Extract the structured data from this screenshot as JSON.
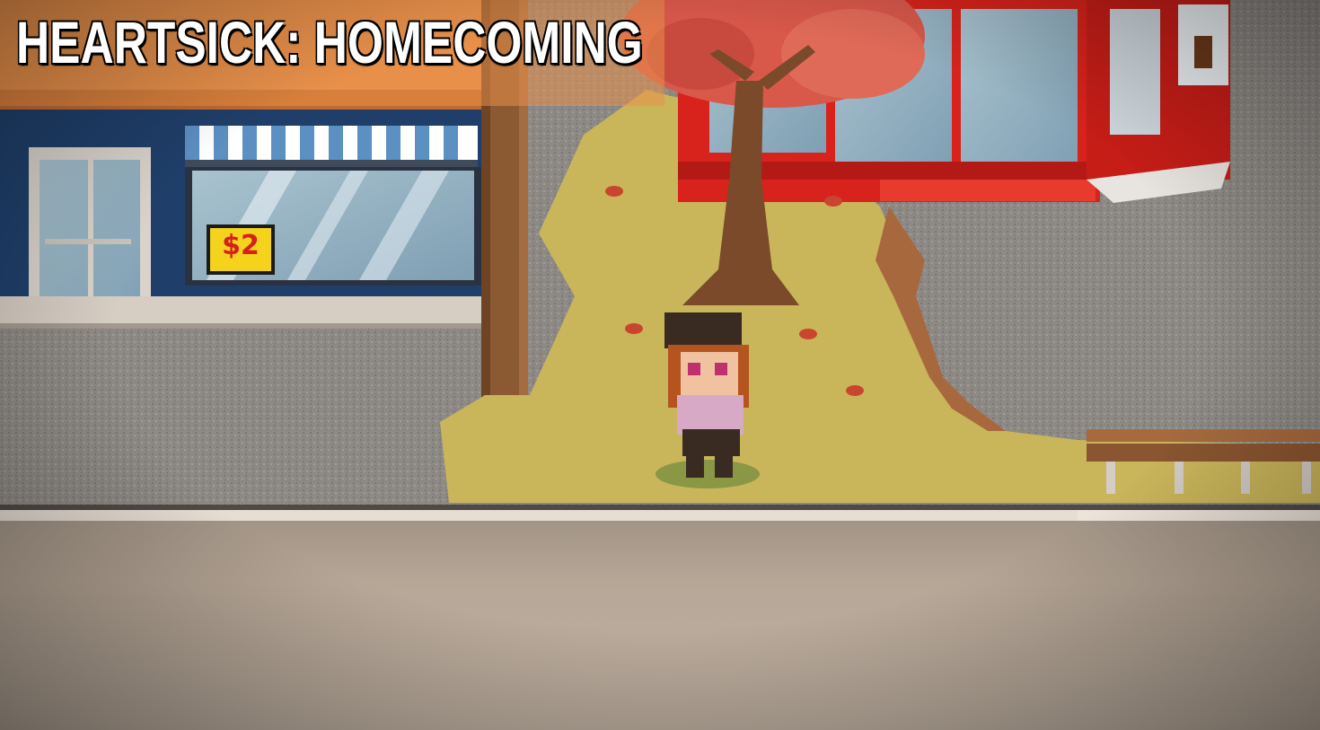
{
  "game": {
    "title": "HEARTSICK: HOMECOMING"
  },
  "scene": {
    "shop_sign_price": "$2",
    "character": "girl-with-beret",
    "colors": {
      "storefront_orange": "#e8904a",
      "shop_blue": "#1f3f6a",
      "store_red": "#d8231c",
      "grass": "#c9b55a",
      "tree_leaves": "#d8584a",
      "pavement": "#8e8a86",
      "road": "#b8a898"
    }
  }
}
